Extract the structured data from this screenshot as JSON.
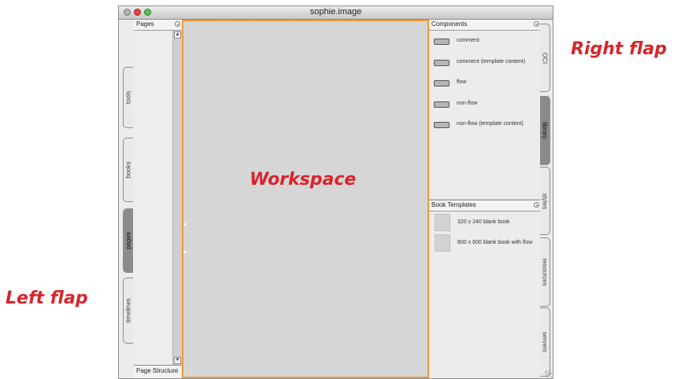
{
  "window": {
    "title": "sophie.image"
  },
  "annotations": {
    "left": "Left flap",
    "right": "Right flap",
    "workspace": "Workspace"
  },
  "left_flap": {
    "tabs": [
      {
        "label": "tools",
        "active": false
      },
      {
        "label": "books",
        "active": false
      },
      {
        "label": "pages",
        "active": true
      },
      {
        "label": "timelines",
        "active": false
      }
    ]
  },
  "pages_panel": {
    "title": "Pages",
    "footer": "Page Structure"
  },
  "components": {
    "title": "Components",
    "items": [
      "comment",
      "comment (template content)",
      "flow",
      "non-flow",
      "non-flow (template content)"
    ]
  },
  "book_templates": {
    "title": "Book Templates",
    "items": [
      "320 x 240 blank book",
      "800 x 600 blank book with flow"
    ]
  },
  "right_flap": {
    "tabs": [
      {
        "label": "OCI",
        "active": false
      },
      {
        "label": "library",
        "active": true
      },
      {
        "label": "styles",
        "active": false
      },
      {
        "label": "resources",
        "active": false
      },
      {
        "label": "servers",
        "active": false
      }
    ]
  }
}
